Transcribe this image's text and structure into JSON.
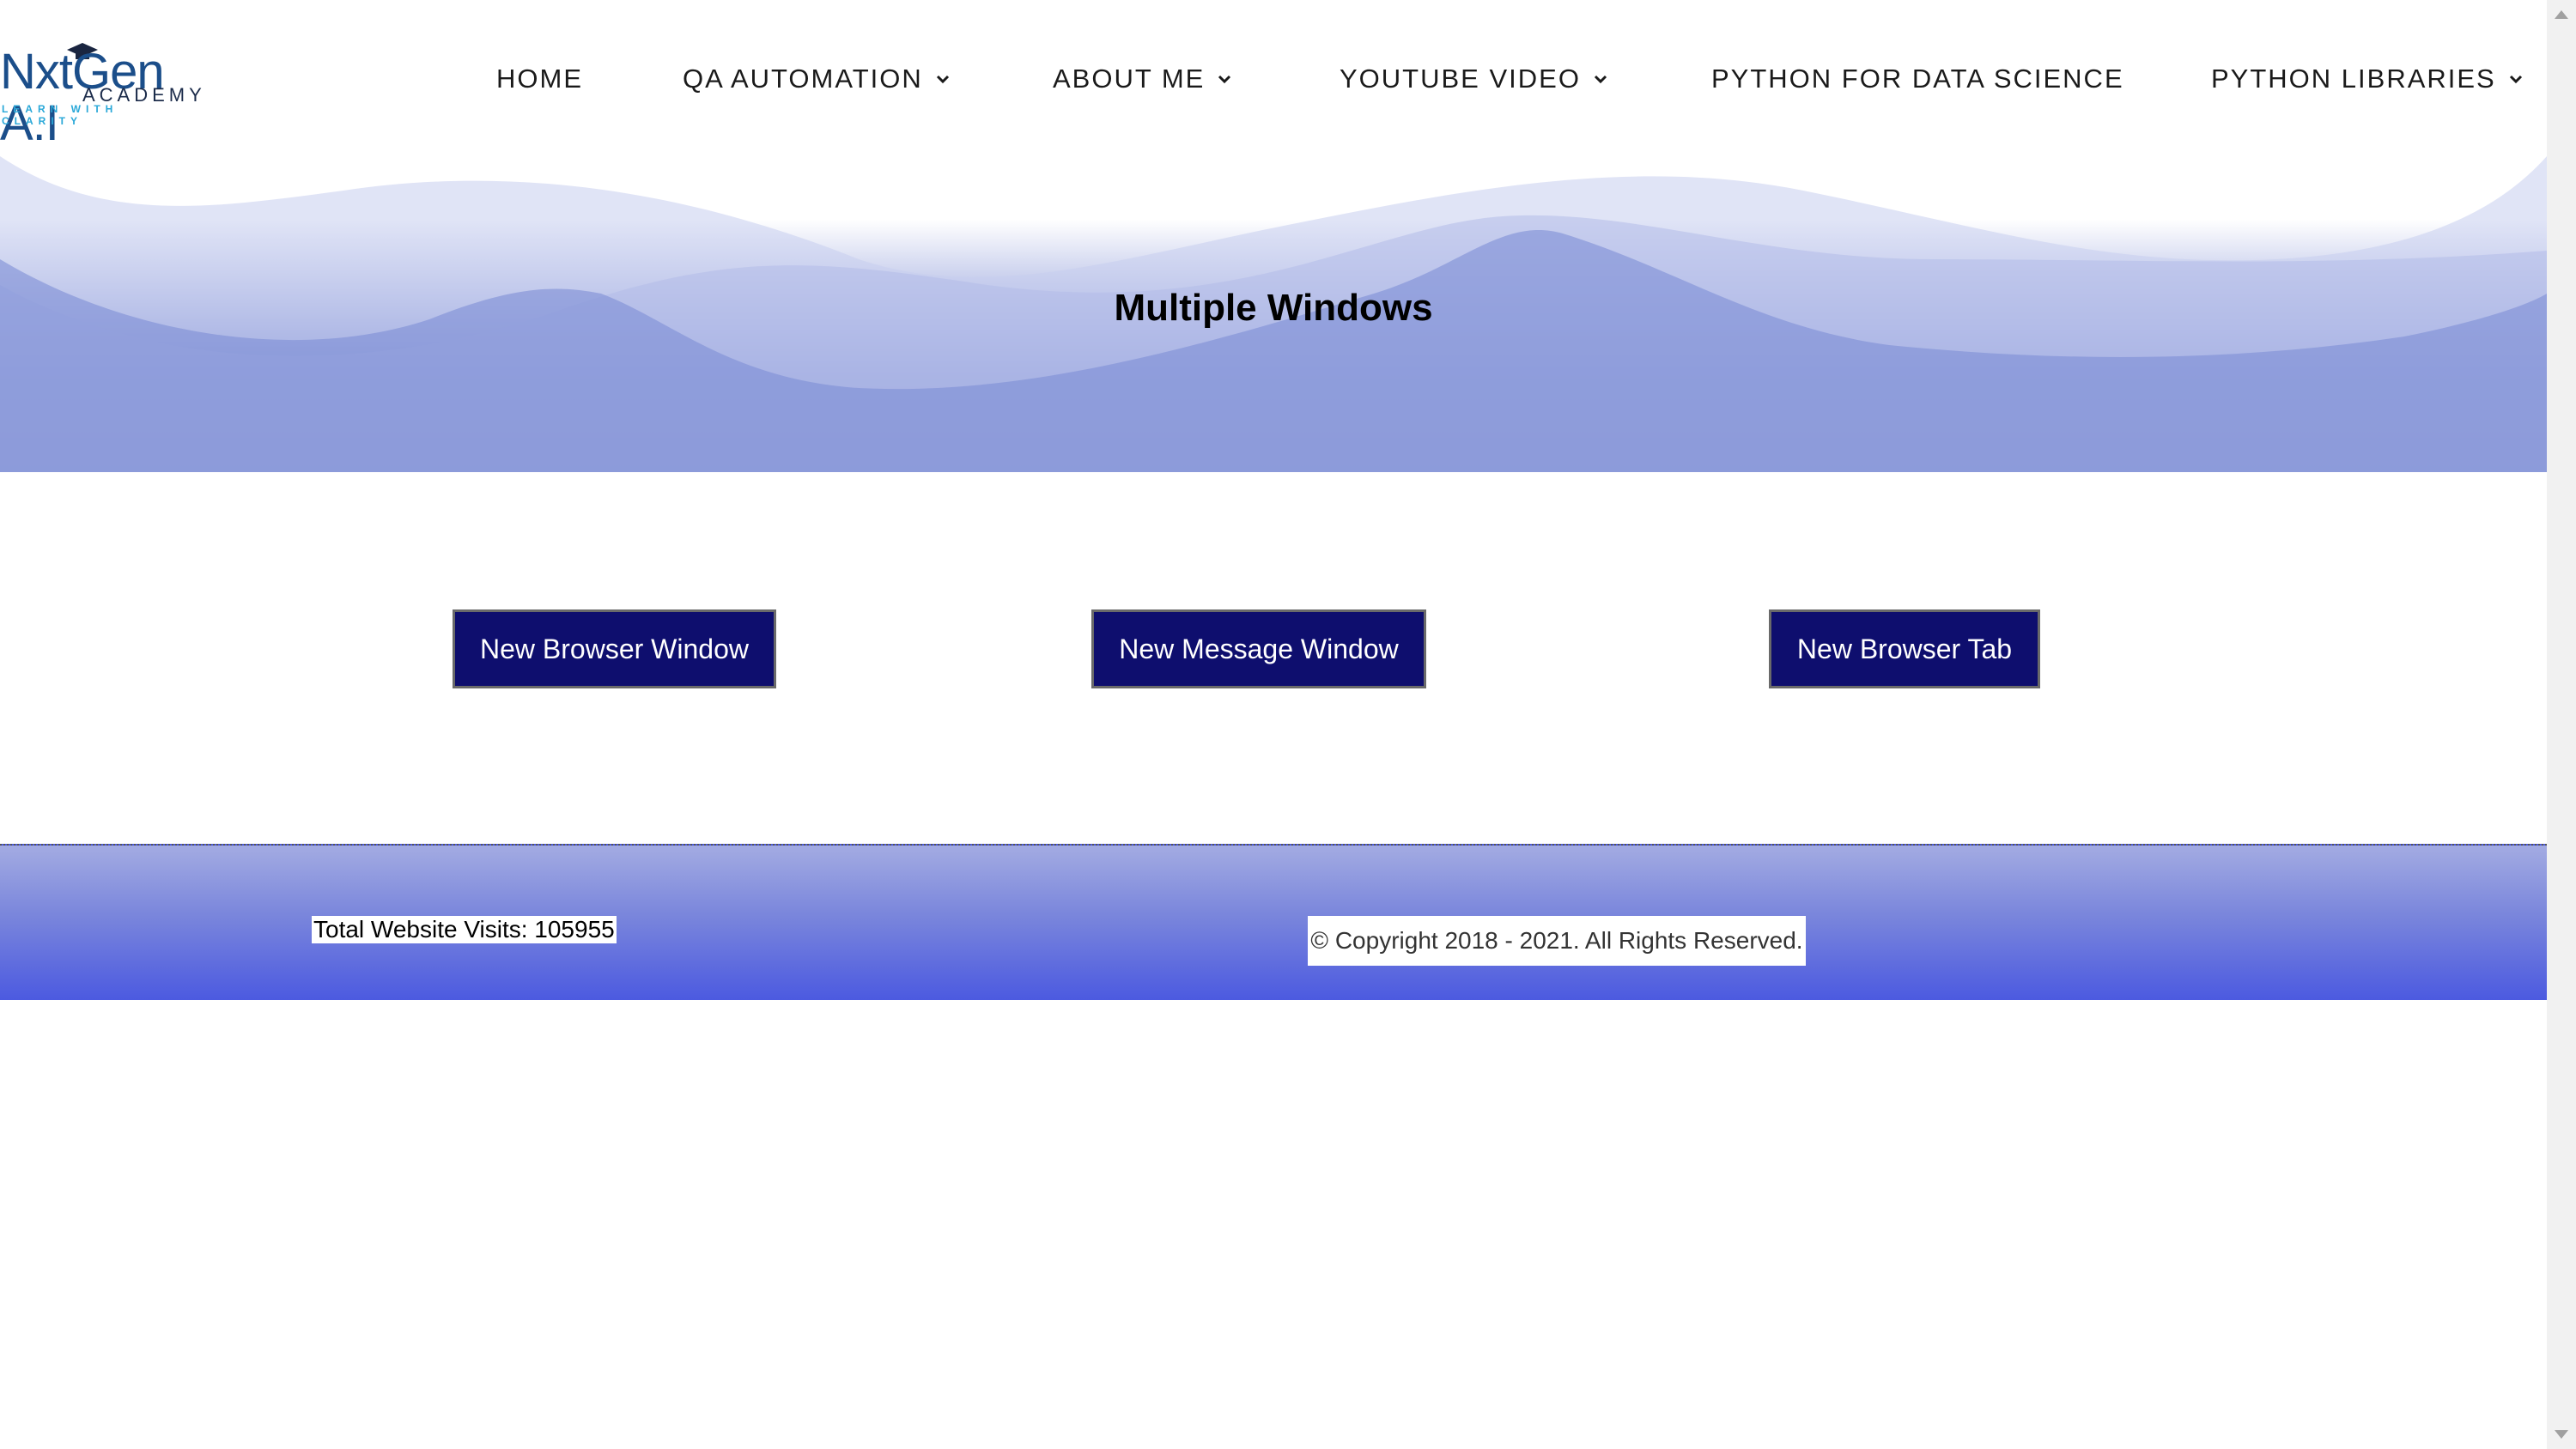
{
  "logo": {
    "main": "NxtGen A.I",
    "sub": "ACADEMY",
    "tagline": "LEARN WITH CLARITY"
  },
  "nav": [
    {
      "label": "HOME",
      "dropdown": false
    },
    {
      "label": "QA AUTOMATION",
      "dropdown": true
    },
    {
      "label": "ABOUT ME",
      "dropdown": true
    },
    {
      "label": "YOUTUBE VIDEO",
      "dropdown": true
    },
    {
      "label": "PYTHON FOR DATA SCIENCE",
      "dropdown": false
    },
    {
      "label": "PYTHON LIBRARIES",
      "dropdown": true
    }
  ],
  "hero": {
    "title": "Multiple Windows"
  },
  "buttons": {
    "browser_window": "New Browser Window",
    "message_window": "New Message Window",
    "browser_tab": "New Browser Tab"
  },
  "footer": {
    "visits": "Total Website Visits: 105955",
    "copyright": "© Copyright 2018 - 2021. All Rights Reserved."
  },
  "colors": {
    "button_bg": "#0e0e6e",
    "hero_wave": "#6f80cf",
    "footer_gradient_bottom": "#4c5ae0"
  }
}
